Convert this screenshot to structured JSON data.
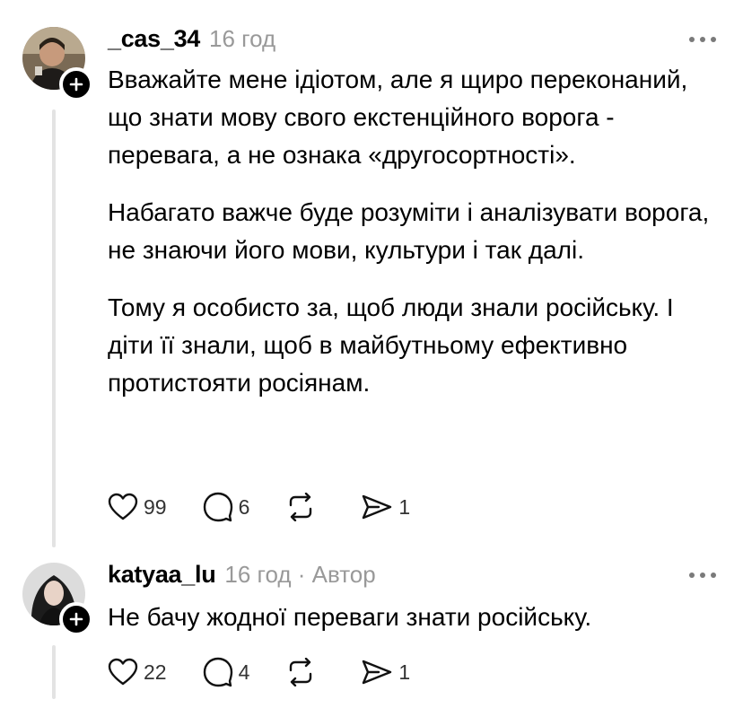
{
  "comments": [
    {
      "username": "_cas_34",
      "meta": "16 год",
      "paragraphs": [
        "Вважайте мене ідіотом, але я щиро переконаний, що знати мову свого екстенційного ворога - перевага, а не ознака «другосортності».",
        "Набагато важче буде розуміти і аналізувати ворога, не знаючи його мови, культури і так далі.",
        "Тому я особисто за, щоб люди знали російську. І діти її знали, щоб в майбутньому ефективно протистояти росіянам."
      ],
      "likes": "99",
      "replies": "6",
      "shares": "1"
    },
    {
      "username": "katyaa_lu",
      "meta": "16 год · Автор",
      "paragraphs": [
        "Не бачу жодної переваги знати російську."
      ],
      "likes": "22",
      "replies": "4",
      "shares": "1"
    }
  ],
  "icons": {
    "like": "heart-icon",
    "reply": "comment-icon",
    "repost": "repost-icon",
    "share": "send-icon",
    "more": "more-icon",
    "follow": "plus-icon"
  }
}
